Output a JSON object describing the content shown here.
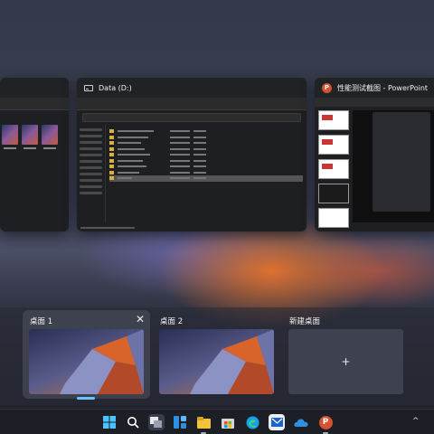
{
  "windows": [
    {
      "id": "explorer-left",
      "title": ""
    },
    {
      "id": "explorer-data",
      "title": "Data (D:)",
      "icon": "drive-icon"
    },
    {
      "id": "powerpoint",
      "title": "性能测试截图 - PowerPoint",
      "icon": "powerpoint-icon"
    }
  ],
  "desktops": [
    {
      "label": "桌面 1",
      "active": true,
      "close_symbol": "✕"
    },
    {
      "label": "桌面 2",
      "active": false
    },
    {
      "label": "新建桌面",
      "add_symbol": "+"
    }
  ],
  "taskbar": {
    "icons": [
      {
        "name": "start-icon"
      },
      {
        "name": "search-icon"
      },
      {
        "name": "task-view-icon"
      },
      {
        "name": "widgets-icon"
      },
      {
        "name": "file-explorer-icon"
      },
      {
        "name": "store-icon"
      },
      {
        "name": "edge-icon"
      },
      {
        "name": "mail-icon"
      },
      {
        "name": "onedrive-icon"
      },
      {
        "name": "powerpoint-icon"
      }
    ],
    "tray_chevron": "^"
  },
  "colors": {
    "accent": "#6cc4ff",
    "taskbar": "#1d1f27",
    "powerpoint": "#d35230"
  }
}
